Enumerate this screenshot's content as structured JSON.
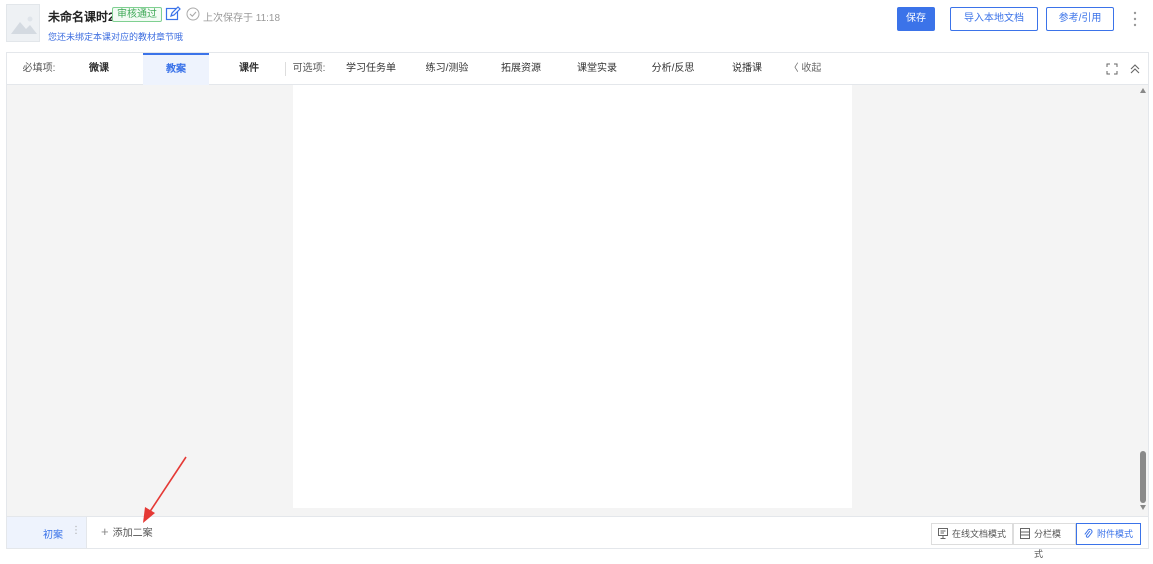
{
  "header": {
    "title": "未命名课时2",
    "badge": "审核通过",
    "saved_text": "上次保存于 11:18",
    "subtitle": "您还未绑定本课对应的教材章节哦",
    "save_label": "保存",
    "import_label": "导入本地文档",
    "ref_label": "参考/引用"
  },
  "tabs": {
    "required_label": "必填项:",
    "required": [
      "微课",
      "教案",
      "课件"
    ],
    "active": "教案",
    "optional_label": "可选项:",
    "optional": [
      "学习任务单",
      "练习/测验",
      "拓展资源",
      "课堂实录",
      "分析/反思",
      "说播课"
    ],
    "collapse": "〈 收起"
  },
  "bottom": {
    "first_tab": "初案",
    "add_label": "添加二案",
    "modes": [
      "在线文档模式",
      "分栏模式",
      "附件模式"
    ],
    "active_mode": "附件模式"
  },
  "colors": {
    "accent": "#3b73e9",
    "badge_green": "#3fa957",
    "arrow_red": "#e53935"
  }
}
